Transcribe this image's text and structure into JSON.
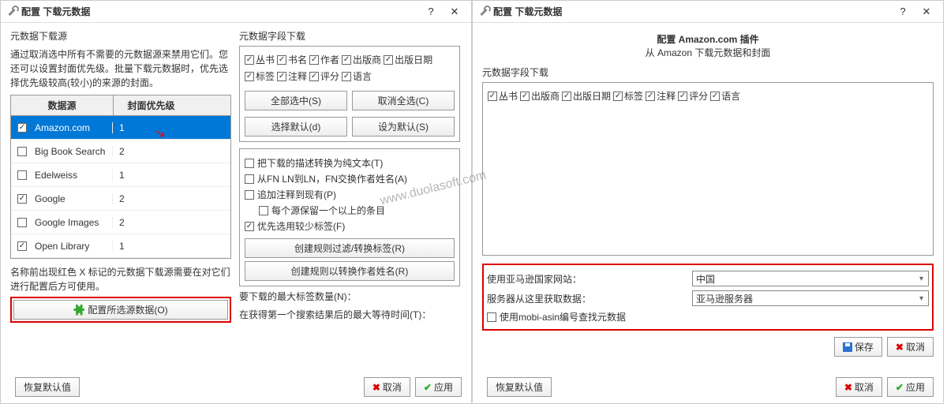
{
  "left": {
    "title": "配置 下载元数据",
    "source_section": "元数据下载源",
    "instructions": "通过取消选中所有不需要的元数据源来禁用它们。您还可以设置封面优先级。批量下载元数据时，优先选择优先级较高(较小)的来源的封面。",
    "table": {
      "header_source": "数据源",
      "header_priority": "封面优先级",
      "rows": [
        {
          "name": "Amazon.com",
          "priority": "1",
          "checked": true,
          "selected": true,
          "arrow": true
        },
        {
          "name": "Big Book Search",
          "priority": "2",
          "checked": false,
          "selected": false
        },
        {
          "name": "Edelweiss",
          "priority": "1",
          "checked": false,
          "selected": false
        },
        {
          "name": "Google",
          "priority": "2",
          "checked": true,
          "selected": false
        },
        {
          "name": "Google Images",
          "priority": "2",
          "checked": false,
          "selected": false
        },
        {
          "name": "Open Library",
          "priority": "1",
          "checked": true,
          "selected": false
        }
      ]
    },
    "note": "名称前出现红色 X 标记的元数据下载源需要在对它们进行配置后方可使用。",
    "config_button": "配置所选源数据(O)",
    "fields_section": "元数据字段下载",
    "fields": [
      "丛书",
      "书名",
      "作者",
      "出版商",
      "出版日期",
      "标签",
      "注释",
      "评分",
      "语言"
    ],
    "btns": {
      "select_all": "全部选中(S)",
      "clear_all": "取消全选(C)",
      "select_default": "选择默认(d)",
      "set_default": "设为默认(S)"
    },
    "options": [
      {
        "label": "把下载的描述转换为纯文本(T)",
        "checked": false
      },
      {
        "label": "从FN LN到LN，FN交换作者姓名(A)",
        "checked": false
      },
      {
        "label": "追加注释到现有(P)",
        "checked": false
      },
      {
        "label": "每个源保留一个以上的条目",
        "checked": false,
        "indent": true
      },
      {
        "label": "优先选用较少标签(F)",
        "checked": true
      }
    ],
    "rule_filter_btn": "创建规则过滤/转换标签(R)",
    "rule_author_btn": "创建规则以转换作者姓名(R)",
    "max_tags": "要下载的最大标签数量(N)：",
    "max_wait": "在获得第一个搜索结果后的最大等待时间(T)：",
    "footer": {
      "restore": "恢复默认值",
      "cancel": "取消",
      "apply": "应用"
    }
  },
  "right": {
    "title": "配置 下载元数据",
    "plugin_title": "配置 Amazon.com 插件",
    "plugin_sub": "从 Amazon 下载元数据和封面",
    "fields_section": "元数据字段下载",
    "fields": [
      "丛书",
      "出版商",
      "出版日期",
      "标签",
      "注释",
      "评分",
      "语言"
    ],
    "settings": {
      "site_label": "使用亚马逊国家网站：",
      "site_value": "中国",
      "server_label": "服务器从这里获取数据：",
      "server_value": "亚马逊服务器",
      "mobi_label": "使用mobi-asin编号查找元数据"
    },
    "save": "保存",
    "cancel": "取消",
    "footer": {
      "restore": "恢复默认值",
      "cancel": "取消",
      "apply": "应用"
    }
  },
  "watermark": "www.duolasoft.com"
}
